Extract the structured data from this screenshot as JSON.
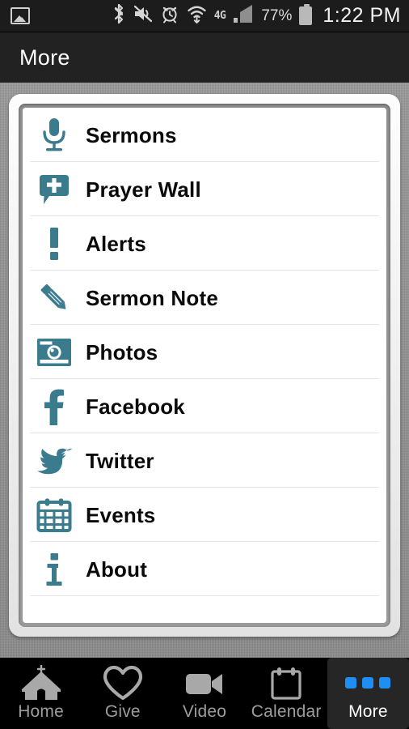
{
  "status_bar": {
    "gallery_icon": "gallery-icon",
    "bluetooth_icon": "bluetooth-icon",
    "mute_icon": "volume-mute-icon",
    "alarm_icon": "alarm-clock-icon",
    "wifi_icon": "wifi-icon",
    "network_label": "4G",
    "signal_icon": "cellular-signal-icon",
    "battery_percent": "77%",
    "battery_icon": "battery-icon",
    "time": "1:22 PM"
  },
  "header": {
    "title": "More"
  },
  "colors": {
    "accent_teal": "#3a7b8e",
    "active_dot_blue": "#1e8ef5",
    "status_bar_bg": "#1c1c1c",
    "title_bar_bg": "#222222",
    "tab_bar_bg": "#000000",
    "tab_active_bg": "#262626",
    "list_bg": "#ffffff",
    "divider": "#e4e4e4",
    "backdrop": "#949494"
  },
  "menu": {
    "items": [
      {
        "label": "Sermons",
        "icon": "microphone-icon"
      },
      {
        "label": "Prayer Wall",
        "icon": "speech-bubble-cross-icon"
      },
      {
        "label": "Alerts",
        "icon": "exclamation-mark-icon"
      },
      {
        "label": "Sermon Note",
        "icon": "pencil-icon"
      },
      {
        "label": "Photos",
        "icon": "camera-icon"
      },
      {
        "label": "Facebook",
        "icon": "facebook-icon"
      },
      {
        "label": "Twitter",
        "icon": "twitter-bird-icon"
      },
      {
        "label": "Events",
        "icon": "calendar-icon"
      },
      {
        "label": "About",
        "icon": "info-icon"
      }
    ]
  },
  "tab_bar": {
    "items": [
      {
        "label": "Home",
        "icon": "church-icon",
        "active": false
      },
      {
        "label": "Give",
        "icon": "heart-icon",
        "active": false
      },
      {
        "label": "Video",
        "icon": "video-camera-icon",
        "active": false
      },
      {
        "label": "Calendar",
        "icon": "calendar-icon",
        "active": false
      },
      {
        "label": "More",
        "icon": "three-dots-icon",
        "active": true
      }
    ]
  }
}
